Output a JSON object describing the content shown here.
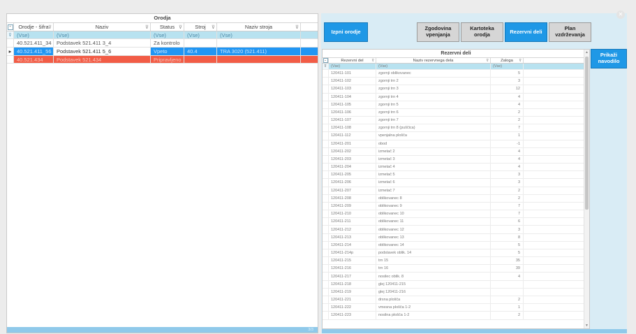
{
  "left": {
    "title": "Orodja",
    "columns": [
      "Orodje - šifra",
      "Naziv",
      "Status",
      "Stroj",
      "Naziv stroja"
    ],
    "filter_row": [
      "(Vse)",
      "(Vse)",
      "(Vse)",
      "(Vse)",
      "(Vse)"
    ],
    "rows": [
      {
        "sifra": "40.521.411_34",
        "naziv": "Podstavek 521.411 3_4",
        "status": "Za kontrolo",
        "stroj": "",
        "naziv_stroja": ""
      },
      {
        "sifra": "40.521.411_56",
        "naziv": "Podstavek 521.411 5_6",
        "status": "Vpeto",
        "stroj": "40.4",
        "naziv_stroja": "TRA 3020 (521.411)"
      },
      {
        "sifra": "40.521.434",
        "naziv": "Podstavek 521.434",
        "status": "Pripravljeno",
        "stroj": "",
        "naziv_stroja": ""
      }
    ],
    "footer_count": "3/3"
  },
  "buttons": {
    "izpni": "Izpni orodje",
    "zgodovina": "Zgodovina vpenjanja",
    "kartoteka": "Kartoteka orodja",
    "rezervni": "Rezervni deli",
    "plan": "Plan vzdrževanja",
    "prikazi": "Prikaži navodilo"
  },
  "right": {
    "title": "Rezervni deli",
    "columns": [
      "Rezervni del",
      "Naziv rezervnega dela",
      "Zaloga"
    ],
    "filter_row": [
      "(Vse)",
      "(Vse)",
      "(Vse)"
    ],
    "rows": [
      [
        "120411-101",
        "zgornji oblikovanec",
        "5"
      ],
      [
        "120411-102",
        "zgornji trn 2",
        "3"
      ],
      [
        "120411-103",
        "zgornji trn 3",
        "12"
      ],
      [
        "120411-104",
        "zgornji trn 4",
        "4"
      ],
      [
        "120411-105",
        "zgornji trn 5",
        "4"
      ],
      [
        "120411-106",
        "zgornji trn 6",
        "2"
      ],
      [
        "120411-107",
        "zgornji trn 7",
        "2"
      ],
      [
        "120411-108",
        "zgornji trn 8 (puščica)",
        "7"
      ],
      [
        "120411-112",
        "vpenjalna plošča",
        "1"
      ],
      [
        "120411-201",
        "obod",
        "-1"
      ],
      [
        "120411-202",
        "izmetač 2",
        "4"
      ],
      [
        "120411-203",
        "izmetač 3",
        "4"
      ],
      [
        "120411-204",
        "izmetač 4",
        "4"
      ],
      [
        "120411-205",
        "izmetač 5",
        "3"
      ],
      [
        "120411-206",
        "izmetač 6",
        "3"
      ],
      [
        "120411-207",
        "izmetač 7",
        "2"
      ],
      [
        "120411-208",
        "oblikovanec 8",
        "2"
      ],
      [
        "120411-209",
        "oblikovanec 9",
        "7"
      ],
      [
        "120411-210",
        "oblikovanec 10",
        "7"
      ],
      [
        "120411-211",
        "oblikovanec 11",
        "6"
      ],
      [
        "120411-212",
        "oblikovanec 12",
        "3"
      ],
      [
        "120411-213",
        "oblikovanec 13",
        "8"
      ],
      [
        "120411-214",
        "oblikovanec 14",
        "5"
      ],
      [
        "120411-214p",
        "podstavek oblik. 14",
        "5"
      ],
      [
        "120411-215",
        "trn 15",
        "35"
      ],
      [
        "120411-216",
        "trn 16",
        "39"
      ],
      [
        "120411-217",
        "nosilec oblik. 8",
        "4"
      ],
      [
        "120411-218",
        "glej 120411-215",
        ""
      ],
      [
        "120411-219",
        "glej 120411-216",
        ""
      ],
      [
        "120411-221",
        "drsna plošča",
        "2"
      ],
      [
        "120411-222",
        "vmesna plošča 1-2",
        "1"
      ],
      [
        "120411-223",
        "nosilna plošča 1-2",
        "2"
      ]
    ]
  },
  "colors": {
    "selected": "#2196f3",
    "red": "#f25c46",
    "filter": "#b8e2f0",
    "button_blue": "#1f98e6"
  }
}
